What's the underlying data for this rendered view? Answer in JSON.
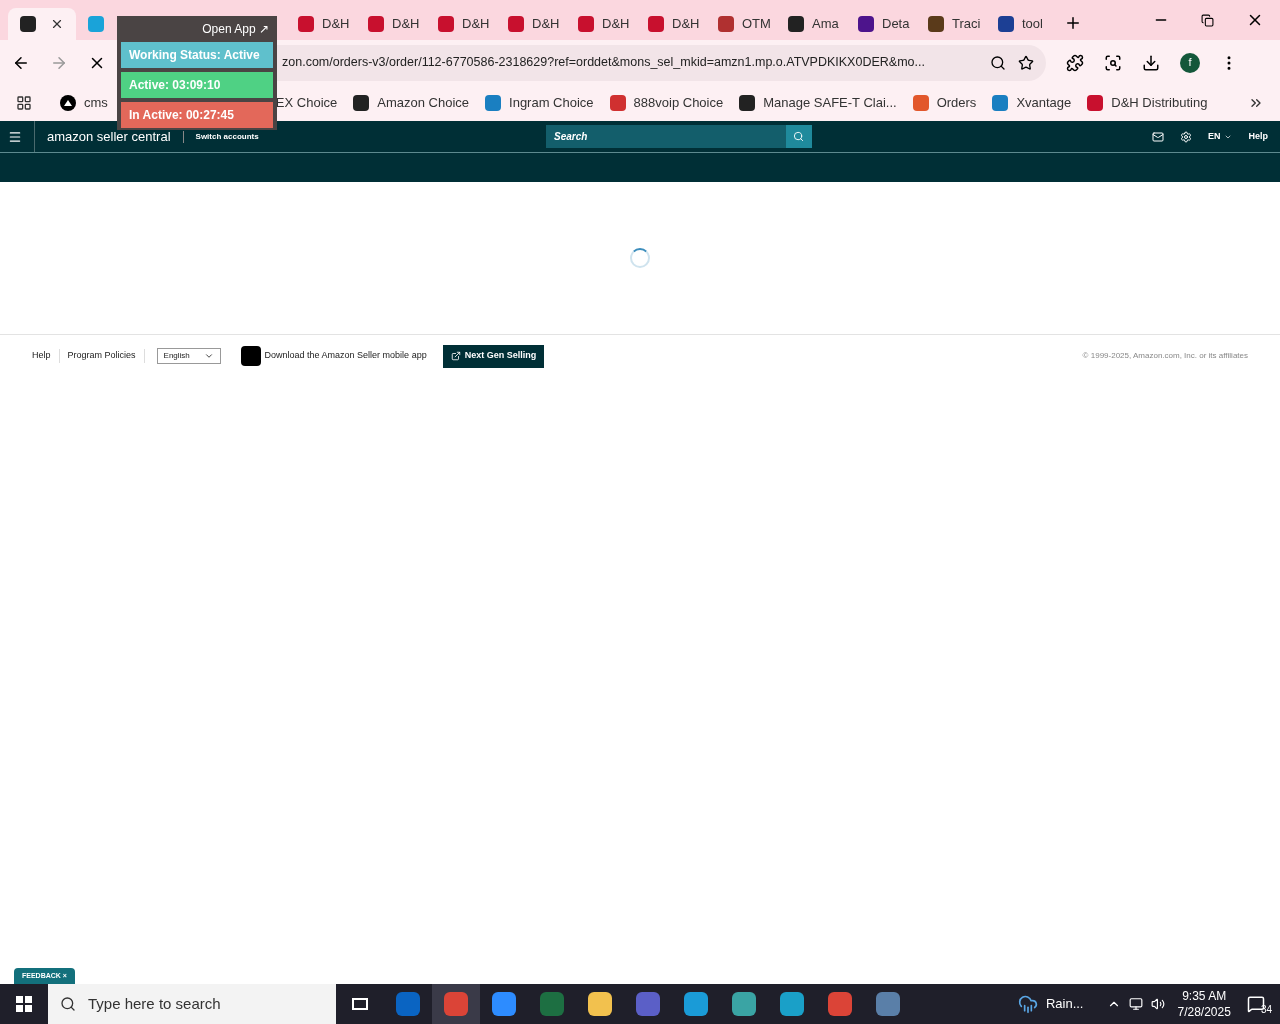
{
  "tabs": [
    {
      "kind": "amazon",
      "selected": true
    },
    {
      "kind": "ec",
      "selected": false
    },
    {
      "kind": "hidden",
      "selected": false
    },
    {
      "kind": "hidden",
      "selected": false
    },
    {
      "kind": "dh",
      "label": "D&H",
      "selected": false
    },
    {
      "kind": "dh",
      "label": "D&H",
      "selected": false
    },
    {
      "kind": "dh",
      "label": "D&H",
      "selected": false
    },
    {
      "kind": "dh",
      "label": "D&H",
      "selected": false
    },
    {
      "kind": "dh",
      "label": "D&H",
      "selected": false
    },
    {
      "kind": "dh",
      "label": "D&H",
      "selected": false
    },
    {
      "kind": "otm",
      "label": "OTM",
      "selected": false
    },
    {
      "kind": "amazon",
      "label": "Ama",
      "selected": false
    },
    {
      "kind": "fedex",
      "label": "Deta",
      "selected": false
    },
    {
      "kind": "ups",
      "label": "Traci",
      "selected": false
    },
    {
      "kind": "usps",
      "label": "tool",
      "selected": false
    }
  ],
  "address_bar": {
    "url": "zon.com/orders-v3/order/112-6770586-2318629?ref=orddet&mons_sel_mkid=amzn1.mp.o.ATVPDKIKX0DER&mo...",
    "profile": "f"
  },
  "bookmarks": [
    {
      "kind": "cms",
      "label": "cms"
    },
    {
      "kind": "gap",
      "label": "EX Choice"
    },
    {
      "kind": "amazon",
      "label": "Amazon Choice"
    },
    {
      "kind": "ingram",
      "label": "Ingram Choice"
    },
    {
      "kind": "voip",
      "label": "888voip Choice"
    },
    {
      "kind": "amazon",
      "label": "Manage SAFE-T Clai..."
    },
    {
      "kind": "orders",
      "label": "Orders"
    },
    {
      "kind": "ingram",
      "label": "Xvantage"
    },
    {
      "kind": "dh",
      "label": "D&H Distributing"
    }
  ],
  "overlay": {
    "open_app": "Open App ↗",
    "rows": [
      {
        "label": "Working Status: Active",
        "color": "#5fc0cc"
      },
      {
        "label": "Active: 03:09:10",
        "color": "#4fd184"
      },
      {
        "label": "In Active: 00:27:45",
        "color": "#e3685a"
      }
    ]
  },
  "seller_header": {
    "logo": "amazon seller central",
    "switch": "Switch accounts",
    "search_placeholder": "Search",
    "language": "EN",
    "help": "Help"
  },
  "footer": {
    "links": [
      "Help",
      "Program Policies"
    ],
    "language": "English",
    "app_link": "Download the Amazon Seller mobile app",
    "next_gen": "Next Gen Selling",
    "copyright": "© 1999-2025, Amazon.com, Inc. or its affiliates"
  },
  "feedback": "FEEDBACK ×",
  "taskbar": {
    "search_placeholder": "Type here to search",
    "weather": "Rain...",
    "time": "9:35 AM",
    "date": "7/28/2025",
    "notifications": "34",
    "apps": [
      {
        "kind": "outlook",
        "selected": false
      },
      {
        "kind": "chrome",
        "selected": true
      },
      {
        "kind": "zoom",
        "selected": false
      },
      {
        "kind": "excel",
        "selected": false
      },
      {
        "kind": "folder",
        "selected": false
      },
      {
        "kind": "teams",
        "selected": false
      },
      {
        "kind": "edge",
        "selected": false
      },
      {
        "kind": "diamond",
        "selected": false
      },
      {
        "kind": "s",
        "selected": false
      },
      {
        "kind": "chrome",
        "selected": false
      },
      {
        "kind": "calc",
        "selected": false
      }
    ]
  }
}
